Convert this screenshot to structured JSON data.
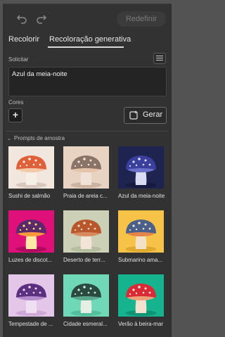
{
  "toolbar": {
    "undo_icon": "undo-icon",
    "redo_icon": "redo-icon",
    "reset_label": "Redefinir"
  },
  "tabs": [
    {
      "label": "Recolorir",
      "active": false
    },
    {
      "label": "Recoloração generativa",
      "active": true
    }
  ],
  "prompt": {
    "label": "Solicitar",
    "value": "Azul da meia-noite",
    "menu_icon": "hamburger-menu-icon"
  },
  "colors": {
    "label": "Cores",
    "add_icon": "plus-icon",
    "generate_label": "Gerar",
    "generate_icon": "generate-sparkle-icon"
  },
  "samples": {
    "label": "Prompts de amostra",
    "chevron_icon": "chevron-down-icon",
    "items": [
      {
        "caption": "Sushi de salmão",
        "bg": "#f2e7df",
        "cap": "#e0603a",
        "spots": "#fff3ea",
        "stem": "#f6efe8",
        "gills": "#f5c8a8",
        "ground": "#d8c8be"
      },
      {
        "caption": "Praia de areia c...",
        "bg": "#e8d3c3",
        "cap": "#8a7367",
        "spots": "#f3e6dc",
        "stem": "#f0e2d6",
        "gills": "#e6c2a8",
        "ground": "#cbb3a2"
      },
      {
        "caption": "Azul da meia-noite",
        "bg": "#1f2350",
        "cap": "#3a3f9e",
        "spots": "#dfe3ff",
        "stem": "#d9dcf2",
        "gills": "#6b70c9",
        "ground": "#161a3c"
      },
      {
        "caption": "Luzes de discot...",
        "bg": "#e0107a",
        "cap": "#5a2a6a",
        "spots": "#ffe27a",
        "stem": "#ffe9a6",
        "gills": "#ff9a3c",
        "ground": "#b00a5f"
      },
      {
        "caption": "Deserto de terr...",
        "bg": "#cbd0b6",
        "cap": "#b8572b",
        "spots": "#f3d9c8",
        "stem": "#f2e4d6",
        "gills": "#d78a5e",
        "ground": "#b7bd9f"
      },
      {
        "caption": "Submarino ama...",
        "bg": "#f6c247",
        "cap": "#4a5f8a",
        "spots": "#f4e6c0",
        "stem": "#f3e0c9",
        "gills": "#e5844a",
        "ground": "#e0a92d"
      },
      {
        "caption": "Tempestade de ...",
        "bg": "#e3c6e8",
        "cap": "#5a3080",
        "spots": "#f0d6f3",
        "stem": "#efdff1",
        "gills": "#b58acb",
        "ground": "#cfa9d6"
      },
      {
        "caption": "Cidade esmeral...",
        "bg": "#6fd8b6",
        "cap": "#2a4a40",
        "spots": "#cfe9de",
        "stem": "#e6efe6",
        "gills": "#5aa88c",
        "ground": "#54bf9b"
      },
      {
        "caption": "Verão à beira-mar",
        "bg": "#16b48e",
        "cap": "#d92a35",
        "spots": "#ffe9e4",
        "stem": "#f5e1cf",
        "gills": "#f2a07a",
        "ground": "#0f9574"
      }
    ]
  }
}
